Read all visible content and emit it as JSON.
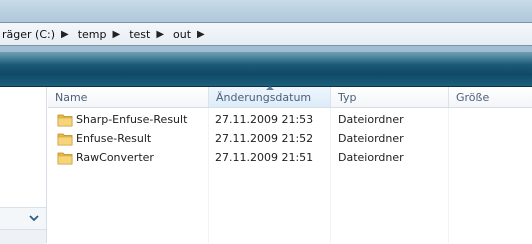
{
  "address": {
    "crumbs": [
      {
        "label": "räger (C:)"
      },
      {
        "label": "temp"
      },
      {
        "label": "test"
      },
      {
        "label": "out"
      }
    ],
    "separator": "▶"
  },
  "columns": {
    "name": "Name",
    "date": "Änderungsdatum",
    "type": "Typ",
    "size": "Größe"
  },
  "files": [
    {
      "name": "Sharp-Enfuse-Result",
      "date": "27.11.2009 21:53",
      "type": "Dateiordner",
      "size": ""
    },
    {
      "name": "Enfuse-Result",
      "date": "27.11.2009 21:52",
      "type": "Dateiordner",
      "size": ""
    },
    {
      "name": "RawConverter",
      "date": "27.11.2009 21:51",
      "type": "Dateiordner",
      "size": ""
    }
  ],
  "colors": {
    "toolbar": "#1a5673",
    "folder": "#f2c85a",
    "header_text": "#4c607a"
  },
  "icons": {
    "folder": "folder-icon",
    "nav_chevron": "chevron-down-icon"
  }
}
